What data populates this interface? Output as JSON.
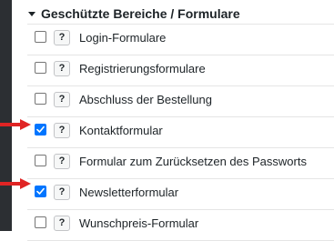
{
  "section": {
    "title": "Geschützte Bereiche / Formulare"
  },
  "help_symbol": "?",
  "items": [
    {
      "label": "Login-Formulare",
      "checked": false,
      "highlighted": false
    },
    {
      "label": "Registrierungsformulare",
      "checked": false,
      "highlighted": false
    },
    {
      "label": "Abschluss der Bestellung",
      "checked": false,
      "highlighted": false
    },
    {
      "label": "Kontaktformular",
      "checked": true,
      "highlighted": true
    },
    {
      "label": "Formular zum Zurücksetzen des Passworts",
      "checked": false,
      "highlighted": false
    },
    {
      "label": "Newsletterformular",
      "checked": true,
      "highlighted": true
    },
    {
      "label": "Wunschpreis-Formular",
      "checked": false,
      "highlighted": false
    }
  ],
  "colors": {
    "accent_checkbox": "#0075ff",
    "annotation_arrow": "#e02424",
    "sidebar_dark": "#2c2f33"
  }
}
